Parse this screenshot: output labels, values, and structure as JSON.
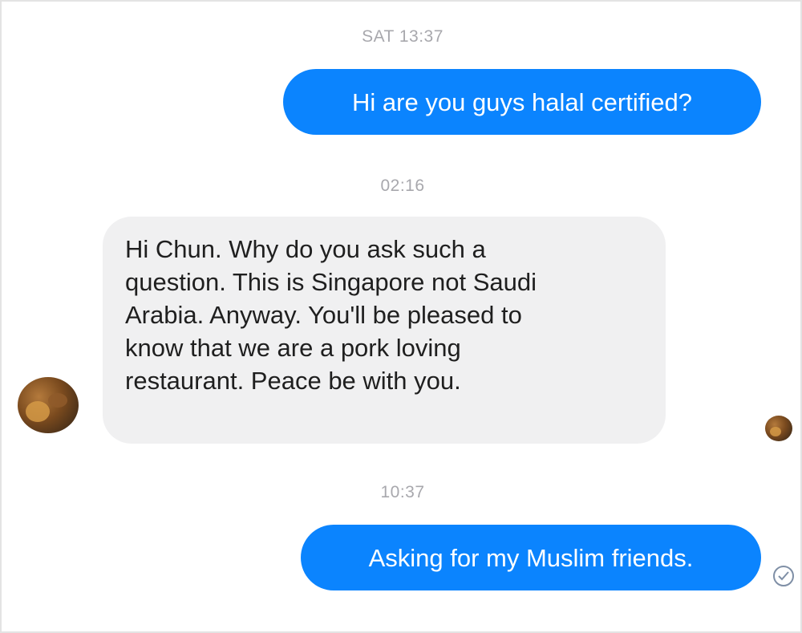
{
  "messages": [
    {
      "timestamp": "SAT 13:37",
      "direction": "outgoing",
      "text": "Hi are you guys halal certified?"
    },
    {
      "timestamp": "02:16",
      "direction": "incoming",
      "text": "Hi Chun. Why do you ask such a\nquestion. This is Singapore not Saudi\nArabia. Anyway. You'll be pleased to\nknow that we are a pork loving\nrestaurant. Peace be with you."
    },
    {
      "timestamp": "10:37",
      "direction": "outgoing",
      "text": "Asking for my Muslim friends."
    }
  ],
  "colors": {
    "outgoing_bubble": "#0b84fe",
    "incoming_bubble": "#f0f0f1",
    "timestamp_text": "#a8a8ad"
  },
  "icons": {
    "sender_avatar": "restaurant-avatar",
    "seen_avatar": "seen-avatar",
    "delivered": "check-circle-icon"
  }
}
